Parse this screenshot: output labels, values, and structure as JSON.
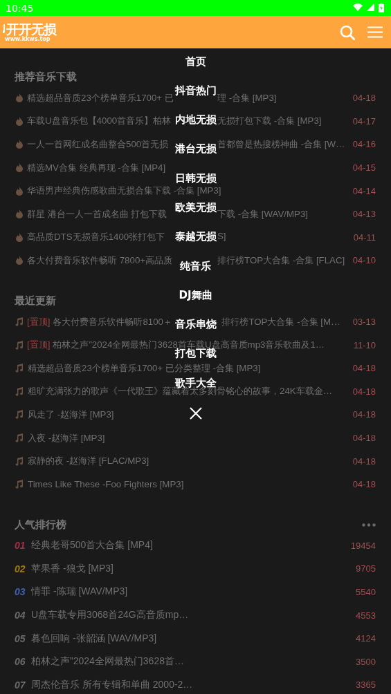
{
  "status_bar": {
    "time": "10:45"
  },
  "header": {
    "logo_title": "开开无损",
    "logo_url": "www.kkws.top"
  },
  "sections": [
    {
      "kind": "recommend",
      "title": "推荐音乐下载",
      "items": [
        {
          "text_parts": [
            "精选超品音质23个榜单音乐1700+ 已",
            "理 -合集 [MP3]"
          ],
          "date": "04-18"
        },
        {
          "text_parts": [
            "车载U盘音乐包【4000首音乐】柏林",
            "无损打包下载 -合集 [MP3]"
          ],
          "date": "04-17"
        },
        {
          "text_parts": [
            "一人一首网红成名曲整合500首无损",
            "首都曾是热搜榜神曲 -合集 [W…"
          ],
          "date": "04-16"
        },
        {
          "text": "精选MV合集 经典再现 -合集 [MP4]",
          "date": "04-15"
        },
        {
          "text": "华语男声经典伤感歌曲无损合集下载 -合集 [MP3]",
          "date": "04-14"
        },
        {
          "text_parts": [
            "群星 港台一人一首成名曲 打包下载",
            "下载 -合集 [WAV/MP3]"
          ],
          "date": "04-13"
        },
        {
          "text_parts": [
            "高品质DTS无损音乐1400张打包下",
            "S]"
          ],
          "date": "04-11"
        },
        {
          "text_parts": [
            "各大付费音乐软件畅听 7800+高品质",
            "排行榜TOP大合集 -合集 [FLAC]"
          ],
          "date": "04-10"
        }
      ]
    },
    {
      "kind": "recent",
      "title": "最近更新",
      "items": [
        {
          "tag": "[置顶]",
          "text_parts": [
            "各大付费音乐软件畅听8100＋",
            "排行榜TOP大合集 -合集 [M…"
          ],
          "date": "03-13"
        },
        {
          "tag": "[置顶]",
          "text": "柏林之声”2024全网最热门3628首车载U盘高音质mp3音乐歌曲及1…",
          "date": "11-10"
        },
        {
          "text": "精选超品音质23个榜单音乐1700+ 已分类整理 -合集 [MP3]",
          "date": "04-18"
        },
        {
          "text": "粗旷充满张力的歌声《一代歌王》蕴藏着太多刻骨铭心的故事，24K车载金…",
          "date": "04-18"
        },
        {
          "text": "风走了 -赵海洋 [MP3]",
          "date": "04-18"
        },
        {
          "text": "入夜 -赵海洋 [MP3]",
          "date": "04-18"
        },
        {
          "text": "寂静的夜 -赵海洋 [FLAC/MP3]",
          "date": "04-18"
        },
        {
          "text": "Times Like These -Foo Fighters [MP3]",
          "date": "04-18"
        }
      ]
    },
    {
      "kind": "ranking",
      "title": "人气排行榜",
      "more": true,
      "items": [
        {
          "rank": "01",
          "color": "#a0304a",
          "text": "经典老哥500首大合集 [MP4]",
          "date": "19454"
        },
        {
          "rank": "02",
          "color": "#a07a10",
          "text": "苹果香 -狼戈 [MP3]",
          "date": "9705"
        },
        {
          "rank": "03",
          "color": "#4060b0",
          "text": "情罪 -陈瑞 [WAV/MP3]",
          "date": "5540"
        },
        {
          "rank": "04",
          "color": "#6a6a6a",
          "text": "U盘车载专用3068首24G高音质mp…",
          "date": "4553"
        },
        {
          "rank": "05",
          "color": "#6a6a6a",
          "text": "暮色回响 -张韶涵 [WAV/MP3]",
          "date": "4124"
        },
        {
          "rank": "06",
          "color": "#6a6a6a",
          "text": "柏林之声”2024全网最热门3628首…",
          "date": "3500"
        },
        {
          "rank": "07",
          "color": "#6a6a6a",
          "text": "周杰伦音乐 所有专辑和单曲 2000-2…",
          "date": "3365"
        }
      ]
    }
  ],
  "menu": {
    "items": [
      "首页",
      "抖音热门",
      "内地无损",
      "港台无损",
      "日韩无损",
      "欧美无损",
      "泰越无损",
      "纯音乐",
      "DJ舞曲",
      "音乐串烧",
      "打包下载",
      "歌手大全"
    ]
  }
}
